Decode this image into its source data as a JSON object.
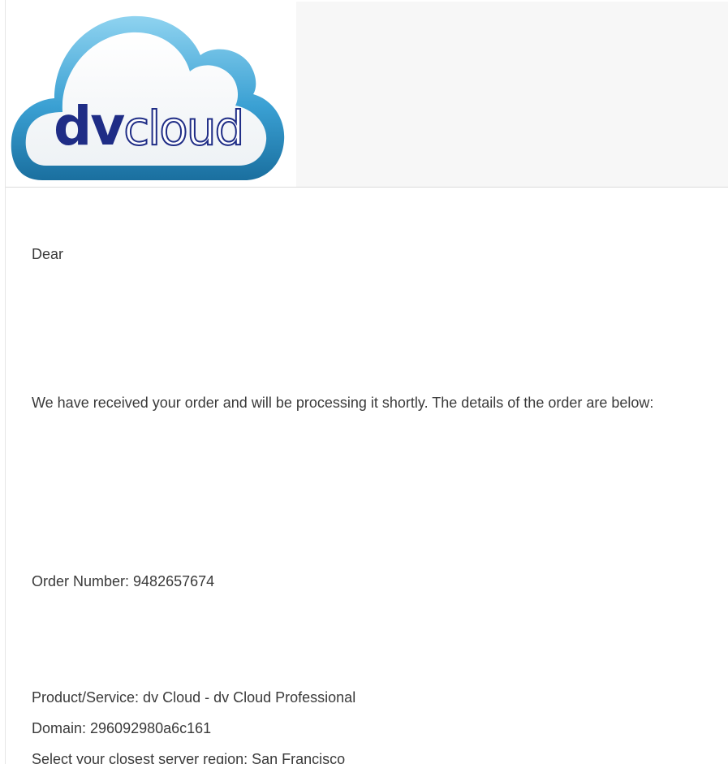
{
  "email": {
    "logo": {
      "text_dv": "dv",
      "text_cloud": "cloud",
      "icon": "cloud-logo-icon"
    },
    "greeting": "Dear",
    "intro": "We have received your order and will be processing it shortly. The details of the order are below:",
    "order_number": "Order Number: 9482657674",
    "product": "Product/Service: dv Cloud - dv Cloud Professional",
    "domain": "Domain: 296092980a6c161",
    "region": "Select your closest server region: San Francisco"
  },
  "colors": {
    "cloud_dark": "#1f7fb3",
    "cloud_light": "#7cc8ea",
    "wordmark": "#1f2d86"
  }
}
